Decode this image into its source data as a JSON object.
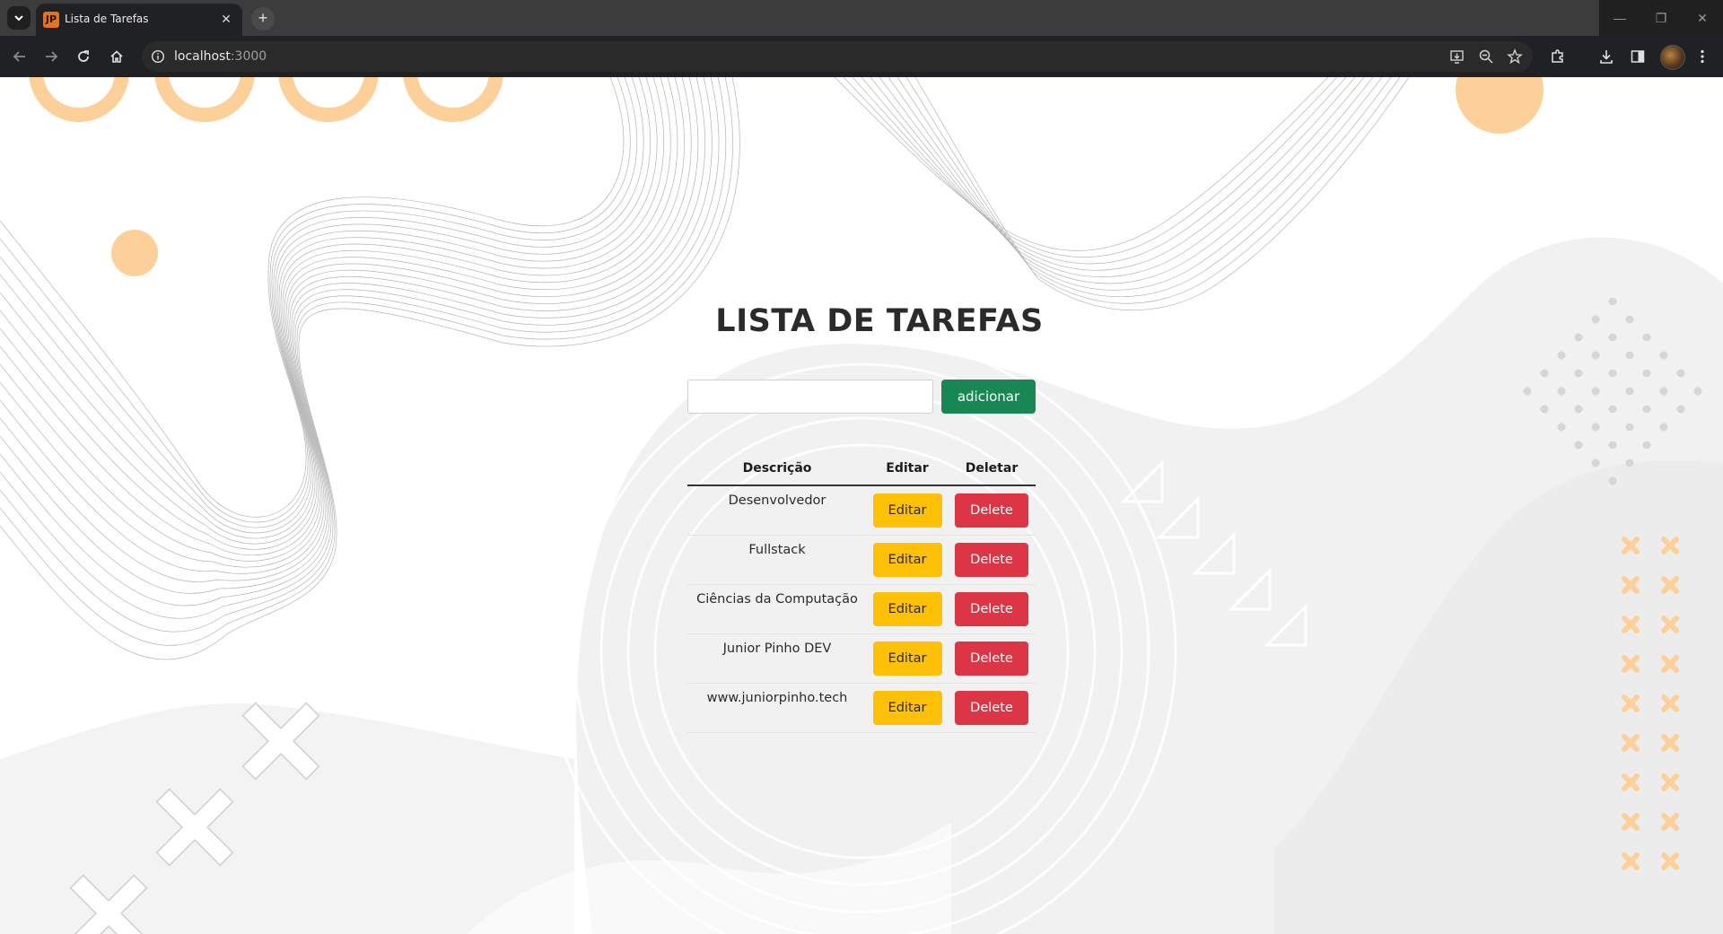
{
  "browser": {
    "tab_title": "Lista de Tarefas",
    "favicon_text": "JP",
    "tab_close_glyph": "✕",
    "new_tab_glyph": "+",
    "url_host": "localhost",
    "url_port": ":3000",
    "window_minimize_glyph": "—",
    "window_restore_glyph": "❐",
    "window_close_glyph": "✕"
  },
  "page": {
    "title": "LISTA DE TAREFAS",
    "input_value": "",
    "input_placeholder": "",
    "add_button_label": "adicionar",
    "table_headers": {
      "description": "Descrição",
      "edit": "Editar",
      "delete": "Deletar"
    },
    "tasks": [
      {
        "description": "Desenvolvedor",
        "edit_label": "Editar",
        "delete_label": "Delete"
      },
      {
        "description": "Fullstack",
        "edit_label": "Editar",
        "delete_label": "Delete"
      },
      {
        "description": "Ciências da Computação",
        "edit_label": "Editar",
        "delete_label": "Delete"
      },
      {
        "description": "Junior Pinho DEV",
        "edit_label": "Editar",
        "delete_label": "Delete"
      },
      {
        "description": "www.juniorpinho.tech",
        "edit_label": "Editar",
        "delete_label": "Delete"
      }
    ]
  },
  "colors": {
    "add_button": "#198754",
    "edit_button": "#ffc107",
    "delete_button": "#dc3545",
    "decor_orange": "#fdd09a",
    "decor_gray": "#f1f1f1"
  }
}
